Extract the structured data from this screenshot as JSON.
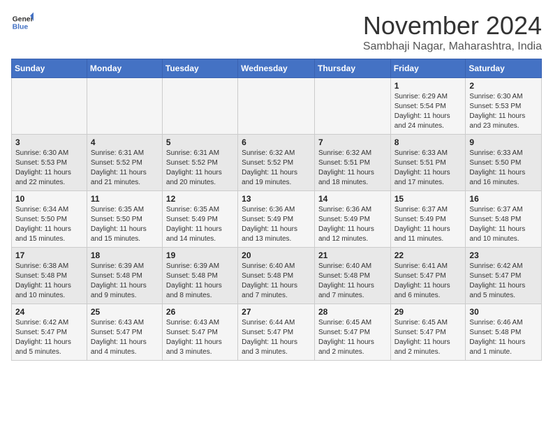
{
  "logo": {
    "line1": "General",
    "line2": "Blue"
  },
  "title": "November 2024",
  "location": "Sambhaji Nagar, Maharashtra, India",
  "weekdays": [
    "Sunday",
    "Monday",
    "Tuesday",
    "Wednesday",
    "Thursday",
    "Friday",
    "Saturday"
  ],
  "weeks": [
    [
      {
        "day": "",
        "info": ""
      },
      {
        "day": "",
        "info": ""
      },
      {
        "day": "",
        "info": ""
      },
      {
        "day": "",
        "info": ""
      },
      {
        "day": "",
        "info": ""
      },
      {
        "day": "1",
        "info": "Sunrise: 6:29 AM\nSunset: 5:54 PM\nDaylight: 11 hours and 24 minutes."
      },
      {
        "day": "2",
        "info": "Sunrise: 6:30 AM\nSunset: 5:53 PM\nDaylight: 11 hours and 23 minutes."
      }
    ],
    [
      {
        "day": "3",
        "info": "Sunrise: 6:30 AM\nSunset: 5:53 PM\nDaylight: 11 hours and 22 minutes."
      },
      {
        "day": "4",
        "info": "Sunrise: 6:31 AM\nSunset: 5:52 PM\nDaylight: 11 hours and 21 minutes."
      },
      {
        "day": "5",
        "info": "Sunrise: 6:31 AM\nSunset: 5:52 PM\nDaylight: 11 hours and 20 minutes."
      },
      {
        "day": "6",
        "info": "Sunrise: 6:32 AM\nSunset: 5:52 PM\nDaylight: 11 hours and 19 minutes."
      },
      {
        "day": "7",
        "info": "Sunrise: 6:32 AM\nSunset: 5:51 PM\nDaylight: 11 hours and 18 minutes."
      },
      {
        "day": "8",
        "info": "Sunrise: 6:33 AM\nSunset: 5:51 PM\nDaylight: 11 hours and 17 minutes."
      },
      {
        "day": "9",
        "info": "Sunrise: 6:33 AM\nSunset: 5:50 PM\nDaylight: 11 hours and 16 minutes."
      }
    ],
    [
      {
        "day": "10",
        "info": "Sunrise: 6:34 AM\nSunset: 5:50 PM\nDaylight: 11 hours and 15 minutes."
      },
      {
        "day": "11",
        "info": "Sunrise: 6:35 AM\nSunset: 5:50 PM\nDaylight: 11 hours and 15 minutes."
      },
      {
        "day": "12",
        "info": "Sunrise: 6:35 AM\nSunset: 5:49 PM\nDaylight: 11 hours and 14 minutes."
      },
      {
        "day": "13",
        "info": "Sunrise: 6:36 AM\nSunset: 5:49 PM\nDaylight: 11 hours and 13 minutes."
      },
      {
        "day": "14",
        "info": "Sunrise: 6:36 AM\nSunset: 5:49 PM\nDaylight: 11 hours and 12 minutes."
      },
      {
        "day": "15",
        "info": "Sunrise: 6:37 AM\nSunset: 5:49 PM\nDaylight: 11 hours and 11 minutes."
      },
      {
        "day": "16",
        "info": "Sunrise: 6:37 AM\nSunset: 5:48 PM\nDaylight: 11 hours and 10 minutes."
      }
    ],
    [
      {
        "day": "17",
        "info": "Sunrise: 6:38 AM\nSunset: 5:48 PM\nDaylight: 11 hours and 10 minutes."
      },
      {
        "day": "18",
        "info": "Sunrise: 6:39 AM\nSunset: 5:48 PM\nDaylight: 11 hours and 9 minutes."
      },
      {
        "day": "19",
        "info": "Sunrise: 6:39 AM\nSunset: 5:48 PM\nDaylight: 11 hours and 8 minutes."
      },
      {
        "day": "20",
        "info": "Sunrise: 6:40 AM\nSunset: 5:48 PM\nDaylight: 11 hours and 7 minutes."
      },
      {
        "day": "21",
        "info": "Sunrise: 6:40 AM\nSunset: 5:48 PM\nDaylight: 11 hours and 7 minutes."
      },
      {
        "day": "22",
        "info": "Sunrise: 6:41 AM\nSunset: 5:47 PM\nDaylight: 11 hours and 6 minutes."
      },
      {
        "day": "23",
        "info": "Sunrise: 6:42 AM\nSunset: 5:47 PM\nDaylight: 11 hours and 5 minutes."
      }
    ],
    [
      {
        "day": "24",
        "info": "Sunrise: 6:42 AM\nSunset: 5:47 PM\nDaylight: 11 hours and 5 minutes."
      },
      {
        "day": "25",
        "info": "Sunrise: 6:43 AM\nSunset: 5:47 PM\nDaylight: 11 hours and 4 minutes."
      },
      {
        "day": "26",
        "info": "Sunrise: 6:43 AM\nSunset: 5:47 PM\nDaylight: 11 hours and 3 minutes."
      },
      {
        "day": "27",
        "info": "Sunrise: 6:44 AM\nSunset: 5:47 PM\nDaylight: 11 hours and 3 minutes."
      },
      {
        "day": "28",
        "info": "Sunrise: 6:45 AM\nSunset: 5:47 PM\nDaylight: 11 hours and 2 minutes."
      },
      {
        "day": "29",
        "info": "Sunrise: 6:45 AM\nSunset: 5:47 PM\nDaylight: 11 hours and 2 minutes."
      },
      {
        "day": "30",
        "info": "Sunrise: 6:46 AM\nSunset: 5:48 PM\nDaylight: 11 hours and 1 minute."
      }
    ]
  ]
}
